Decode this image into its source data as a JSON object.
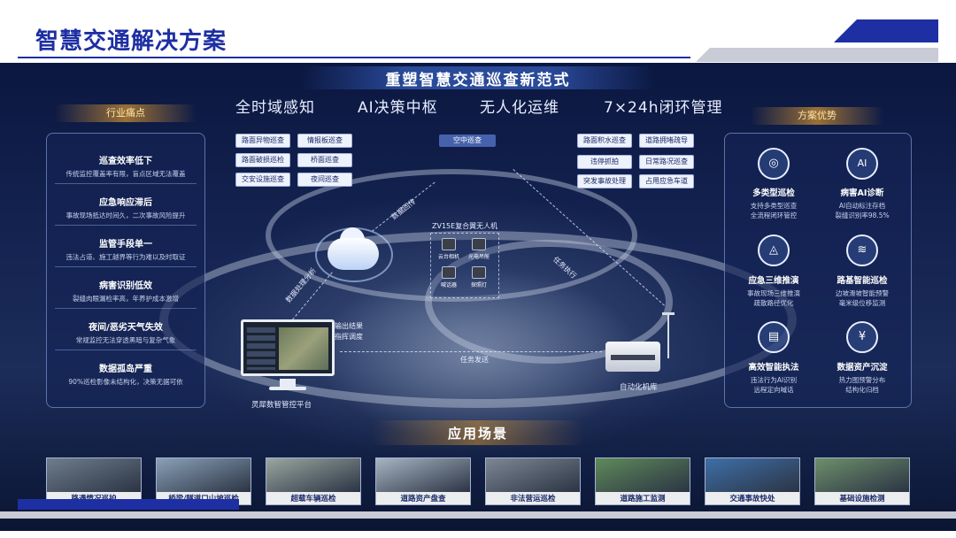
{
  "header": {
    "title": "智慧交通解决方案"
  },
  "board": {
    "title": "重塑智慧交通巡查新范式",
    "slogans": [
      "全时域感知",
      "AI决策中枢",
      "无人化运维",
      "7×24h闭环管理"
    ]
  },
  "pain_points": {
    "heading": "行业痛点",
    "items": [
      {
        "title": "巡查效率低下",
        "desc": "传统监控覆盖率有限，盲点区域无法覆盖"
      },
      {
        "title": "应急响应滞后",
        "desc": "事故现场抵达时间久，二次事故风险提升"
      },
      {
        "title": "监管手段单一",
        "desc": "违法占道、施工越界等行为难以及时取证"
      },
      {
        "title": "病害识别低效",
        "desc": "裂缝肉眼漏检率高，年养护成本激增"
      },
      {
        "title": "夜间/恶劣天气失效",
        "desc": "常规监控无法穿透黑暗与复杂气象"
      },
      {
        "title": "数据孤岛严重",
        "desc": "90%巡检影像未结构化，决策无据可依"
      }
    ]
  },
  "center": {
    "left_tags": [
      "路面异物巡查",
      "情报板巡查",
      "路面破损巡检",
      "桥面巡查",
      "交安设施巡查",
      "夜间巡查"
    ],
    "right_tags": [
      "路面积水巡查",
      "道路拥堵疏导",
      "违停抓拍",
      "日常路况巡查",
      "突发事故处理",
      "占用应急车道"
    ],
    "air_patrol": "空中巡查",
    "drone_name": "ZV15E复合翼无人机",
    "payloads": [
      "云台相机",
      "光电吊舱",
      "喊话器",
      "探照灯"
    ],
    "flow": {
      "data_return": "数据回传",
      "data_analysis": "数据处理分析",
      "task_exec": "任务执行",
      "task_send": "任务发送",
      "output": "输出结果",
      "dispatch": "指挥调度"
    },
    "platform": "灵犀数智管控平台",
    "hangar": "自动化机库"
  },
  "advantages": {
    "heading": "方案优势",
    "items": [
      {
        "icon": "target-icon",
        "glyph": "◎",
        "title": "多类型巡检",
        "desc1": "支持多类型巡查",
        "desc2": "全流程闭环管控"
      },
      {
        "icon": "ai-icon",
        "glyph": "AI",
        "title": "病害AI诊断",
        "desc1": "AI自动标注存档",
        "desc2": "裂缝识别率98.5%"
      },
      {
        "icon": "emergency-icon",
        "glyph": "◬",
        "title": "应急三维推演",
        "desc1": "事故现场三维推演",
        "desc2": "疏散路径优化"
      },
      {
        "icon": "road-icon",
        "glyph": "≋",
        "title": "路基智能巡检",
        "desc1": "边坡滑坡智能预警",
        "desc2": "毫米级位移监测"
      },
      {
        "icon": "document-icon",
        "glyph": "▤",
        "title": "高效智能执法",
        "desc1": "违法行为AI识别",
        "desc2": "远程定向喊话"
      },
      {
        "icon": "asset-icon",
        "glyph": "¥",
        "title": "数据资产沉淀",
        "desc1": "热力图预警分布",
        "desc2": "结构化归档"
      }
    ]
  },
  "scenes": {
    "heading": "应用场景",
    "items": [
      {
        "label": "路遇情况巡护",
        "color": "#6f7d8c"
      },
      {
        "label": "桥梁/隧道口山坡巡检",
        "color": "#8aa0b8"
      },
      {
        "label": "超载车辆巡检",
        "color": "#9aa6a0"
      },
      {
        "label": "道路资产盘查",
        "color": "#a7b4c2"
      },
      {
        "label": "非法营运巡检",
        "color": "#7d8794"
      },
      {
        "label": "道路施工监测",
        "color": "#5f8a5a"
      },
      {
        "label": "交通事故快处",
        "color": "#3e6fa8"
      },
      {
        "label": "基础设施检测",
        "color": "#6e8f6a"
      }
    ]
  }
}
